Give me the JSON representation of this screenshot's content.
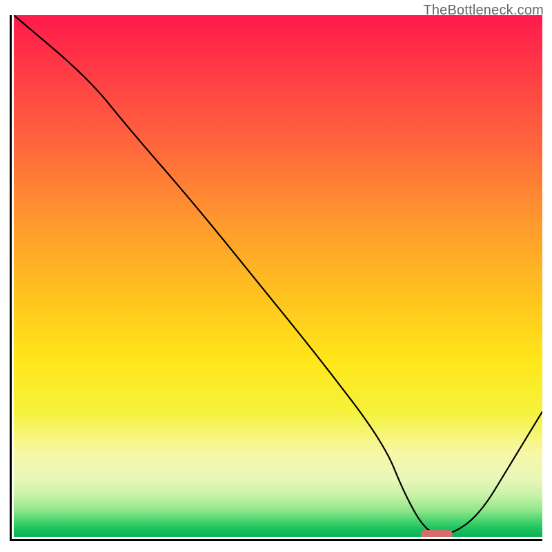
{
  "watermark": "TheBottleneck.com",
  "chart_data": {
    "type": "line",
    "title": "",
    "xlabel": "",
    "ylabel": "",
    "xlim": [
      0,
      100
    ],
    "ylim": [
      0,
      100
    ],
    "series": [
      {
        "name": "bottleneck-curve",
        "x": [
          0,
          14,
          22,
          34,
          46,
          58,
          70,
          74,
          78,
          82,
          88,
          94,
          100
        ],
        "values": [
          100,
          88,
          78,
          64,
          49,
          34,
          18,
          8,
          1,
          0,
          4,
          14,
          24
        ]
      }
    ],
    "annotations": [
      {
        "name": "optimal-marker",
        "x": 80,
        "y": 0.5,
        "color": "#d86b6b"
      }
    ],
    "background_gradient": {
      "top": "#ff1a4b",
      "mid": "#ffe61a",
      "bottom": "#0ab054"
    },
    "colors": {
      "curve": "#000000",
      "axes": "#000000",
      "marker": "#d86b6b",
      "watermark": "#666666"
    }
  }
}
